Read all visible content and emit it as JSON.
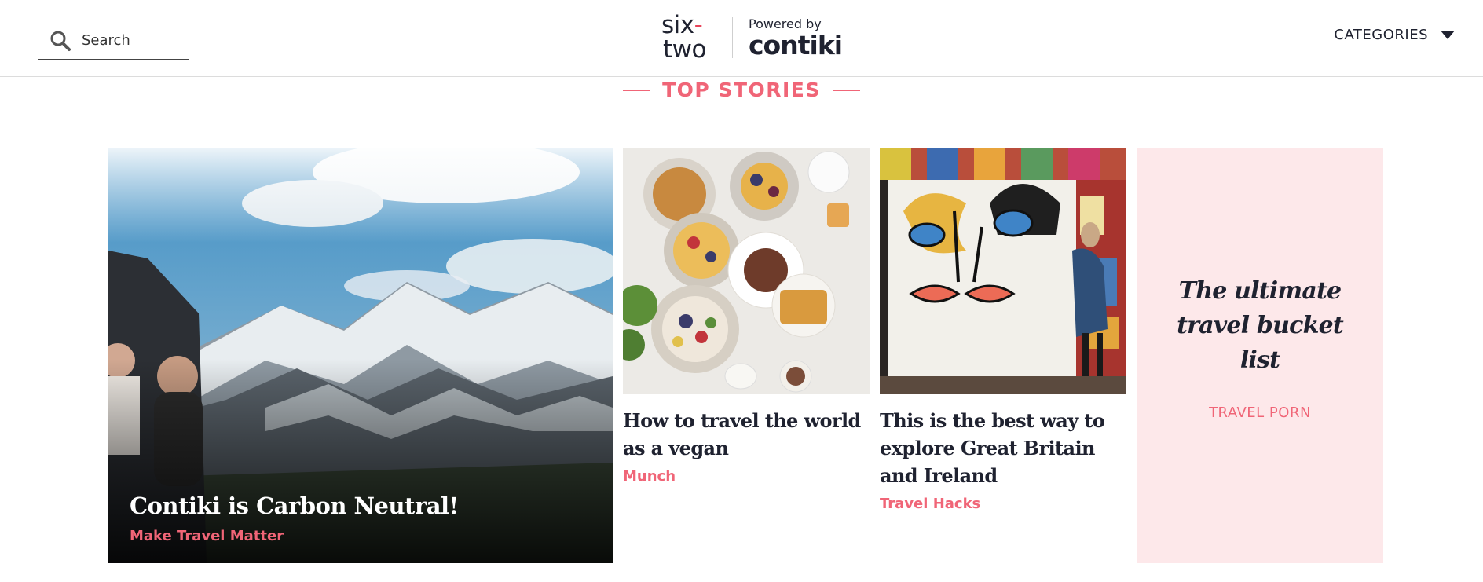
{
  "header": {
    "search": {
      "placeholder": "Search"
    },
    "logo": {
      "six": "six",
      "dash": "-",
      "two": "two"
    },
    "powered_by": "Powered by",
    "partner_logo": "contiki",
    "categories_label": "CATEGORIES"
  },
  "section": {
    "heading": "TOP STORIES"
  },
  "stories": {
    "featured": {
      "title": "Contiki is Carbon Neutral!",
      "category": "Make Travel Matter"
    },
    "items": [
      {
        "title": "How to travel the world as a vegan",
        "category": "Munch"
      },
      {
        "title": "This is the best way to explore Great Britain and Ireland",
        "category": "Travel Hacks"
      }
    ],
    "promo": {
      "title": "The ultimate travel bucket list",
      "category": "TRAVEL PORN"
    }
  },
  "colors": {
    "accent": "#f06577",
    "text": "#1f2230",
    "promo_bg": "#fde8ea"
  },
  "icons": {
    "search": "search-icon",
    "categories": "caret-down-icon"
  }
}
